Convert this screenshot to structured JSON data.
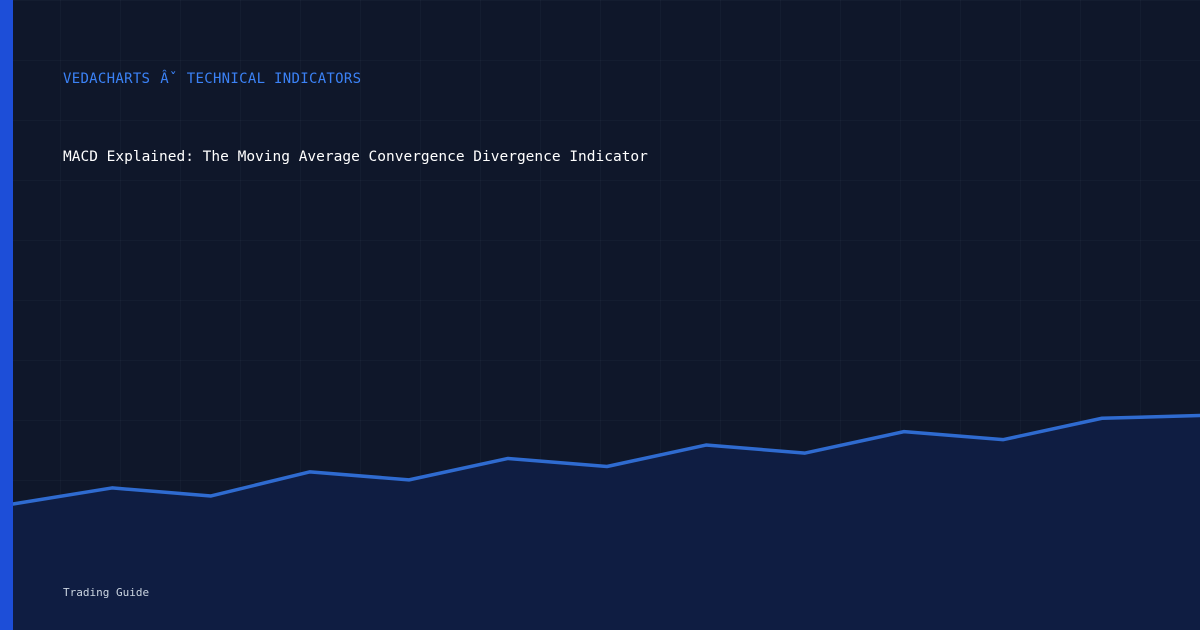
{
  "breadcrumb": {
    "brand": "VEDACHARTS",
    "separator": "Âˇ",
    "section": "TECHNICAL INDICATORS"
  },
  "title": "MACD Explained: The Moving Average Convergence Divergence Indicator",
  "footer": "Trading Guide",
  "colors": {
    "background": "#0f172a",
    "accent": "#1d4ed8",
    "line": "#2f6bd0",
    "area_fill": "#0f1d42",
    "breadcrumb_text": "#3b82f6",
    "title_text": "#ffffff",
    "footer_text": "#cbd5e1"
  },
  "decorative_line": {
    "values": [
      0,
      12,
      6,
      24,
      18,
      34,
      28,
      44,
      38,
      54,
      48,
      64,
      66
    ]
  }
}
